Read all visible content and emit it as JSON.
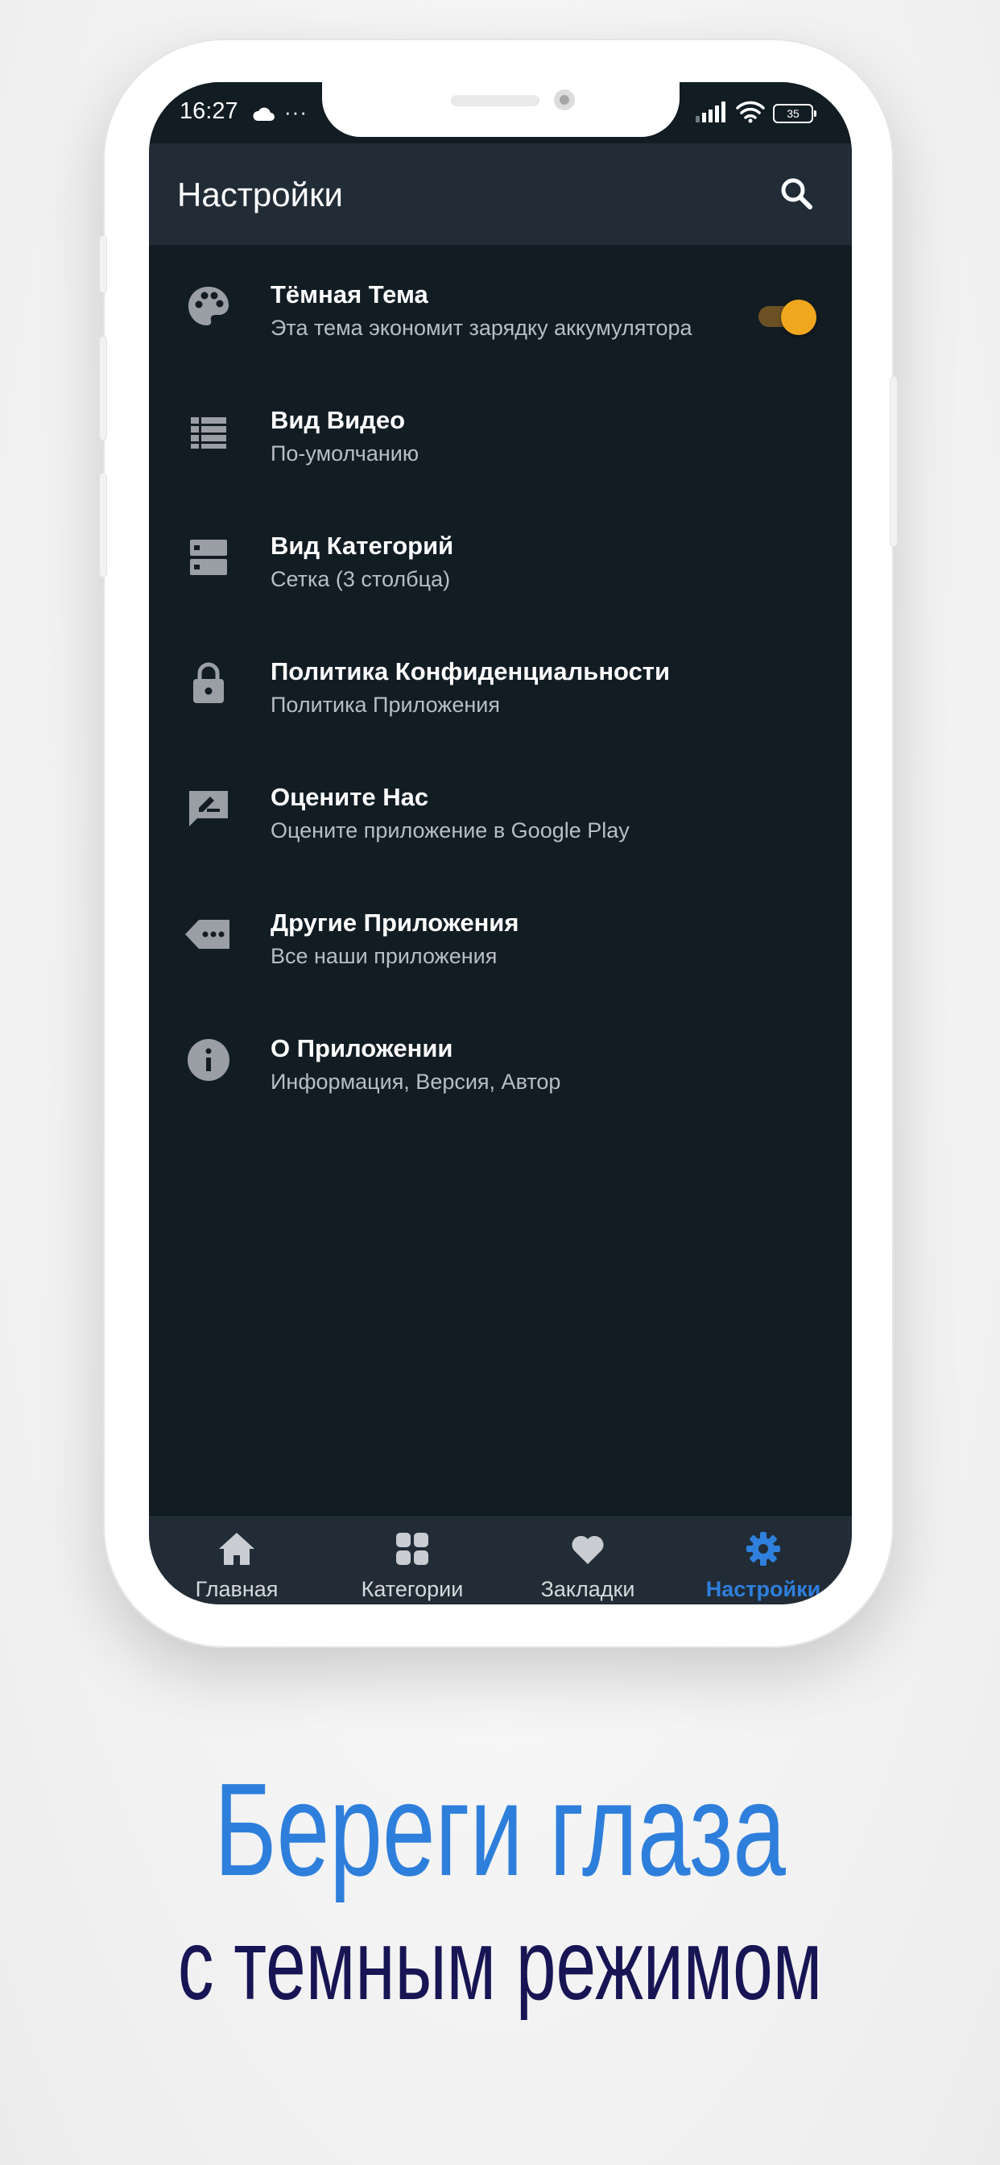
{
  "status_bar": {
    "time": "16:27",
    "more_indicator": "···",
    "battery_level": "35",
    "icons": [
      "cloud-icon",
      "signal-icon",
      "wifi-icon",
      "battery-icon"
    ]
  },
  "app_bar": {
    "title": "Настройки",
    "search_icon": "search-icon"
  },
  "settings": [
    {
      "title": "Тёмная Тема",
      "subtitle": "Эта тема экономит зарядку аккумулятора",
      "icon": "palette-icon",
      "toggle_on": true
    },
    {
      "title": "Вид Видео",
      "subtitle": "По-умолчанию",
      "icon": "list-view-icon"
    },
    {
      "title": "Вид Категорий",
      "subtitle": "Сетка (3 столбца)",
      "icon": "grid-view-icon"
    },
    {
      "title": "Политика Конфиденциальности",
      "subtitle": "Политика Приложения",
      "icon": "lock-icon"
    },
    {
      "title": "Оцените Нас",
      "subtitle": "Оцените приложение в Google Play",
      "icon": "rate-review-icon"
    },
    {
      "title": "Другие Приложения",
      "subtitle": "Все наши приложения",
      "icon": "more-apps-icon"
    },
    {
      "title": "О Приложении",
      "subtitle": "Информация, Версия, Автор",
      "icon": "info-icon"
    }
  ],
  "bottom_nav": {
    "items": [
      {
        "label": "Главная",
        "icon": "home-icon",
        "active": false
      },
      {
        "label": "Категории",
        "icon": "categories-icon",
        "active": false
      },
      {
        "label": "Закладки",
        "icon": "heart-icon",
        "active": false
      },
      {
        "label": "Настройки",
        "icon": "gear-icon",
        "active": true
      }
    ]
  },
  "promo": {
    "headline": "Береги глаза",
    "subline": "с темным режимом"
  },
  "colors": {
    "screen_bg": "#121c23",
    "app_bar_bg": "#212c36",
    "accent_orange": "#f0a71e",
    "accent_blue": "#2e7fdc",
    "promo_sub": "#171554"
  }
}
